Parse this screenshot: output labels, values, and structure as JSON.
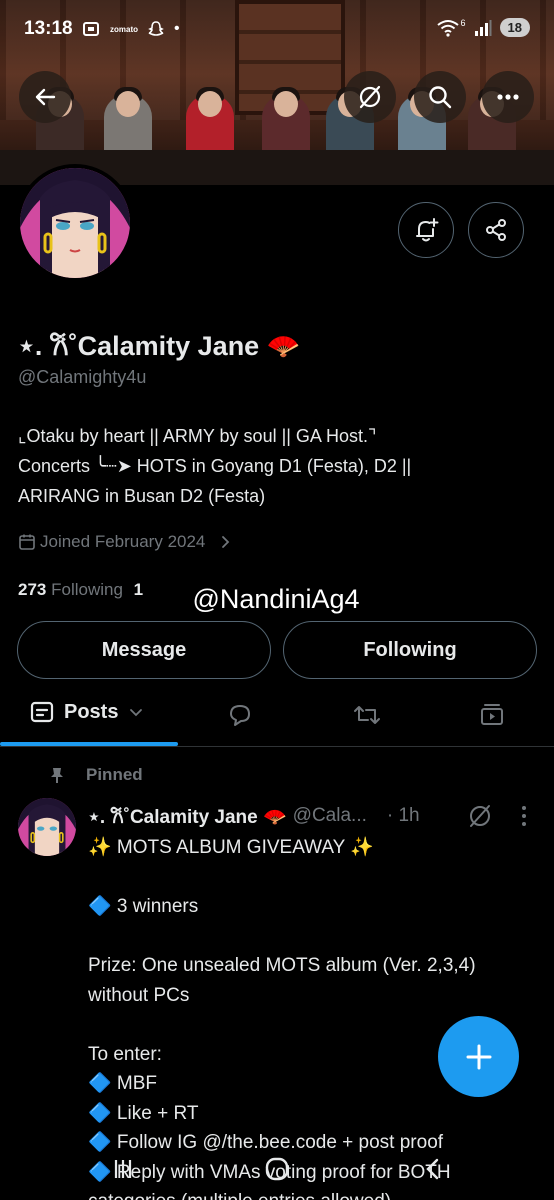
{
  "status_bar": {
    "time": "13:18",
    "battery": "18",
    "notif_label": "zomato",
    "dot": "•",
    "signal_tag": "6"
  },
  "header": {
    "back_icon": "arrow-left-icon",
    "grok_icon": "grok-icon",
    "search_icon": "search-icon",
    "more_icon": "more-icon"
  },
  "profile": {
    "name": "⋆. 𐙚˚Calamity Jane 🪭",
    "handle": "@Calamighty4u",
    "bio": "⌞Otaku by heart || ARMY by soul || GA Host.⌝\nConcerts ╰┈➤ HOTS in Goyang D1 (Festa), D2 ||\nARIRANG in Busan D2 (Festa)",
    "joined": "Joined February 2024",
    "following_count": "273",
    "following_label": "Following",
    "followers_count_partial": "1",
    "watermark": "@NandiniAg4"
  },
  "actions": {
    "message_label": "Message",
    "following_label": "Following"
  },
  "tabs": {
    "posts_label": "Posts"
  },
  "post": {
    "pinned_label": "Pinned",
    "author_name": "⋆. 𐙚˚Calamity Jane 🪭",
    "author_handle": "@Cala...",
    "time": "· 1h",
    "body": "✨ MOTS ALBUM GIVEAWAY ✨\n\n🔷 3 winners\n\nPrize: One unsealed MOTS album (Ver. 2,3,4) without PCs\n\nTo enter:\n🔷 MBF\n🔷 Like + RT\n🔷 Follow IG @/the.bee.code + post proof\n🔷 Reply with VMAs voting proof for BOTH categories (multiple entries allowed)"
  },
  "colors": {
    "accent": "#1d9bf0",
    "muted": "#71767b",
    "border": "#536471",
    "text": "#e7e9ea",
    "background": "#000000"
  }
}
